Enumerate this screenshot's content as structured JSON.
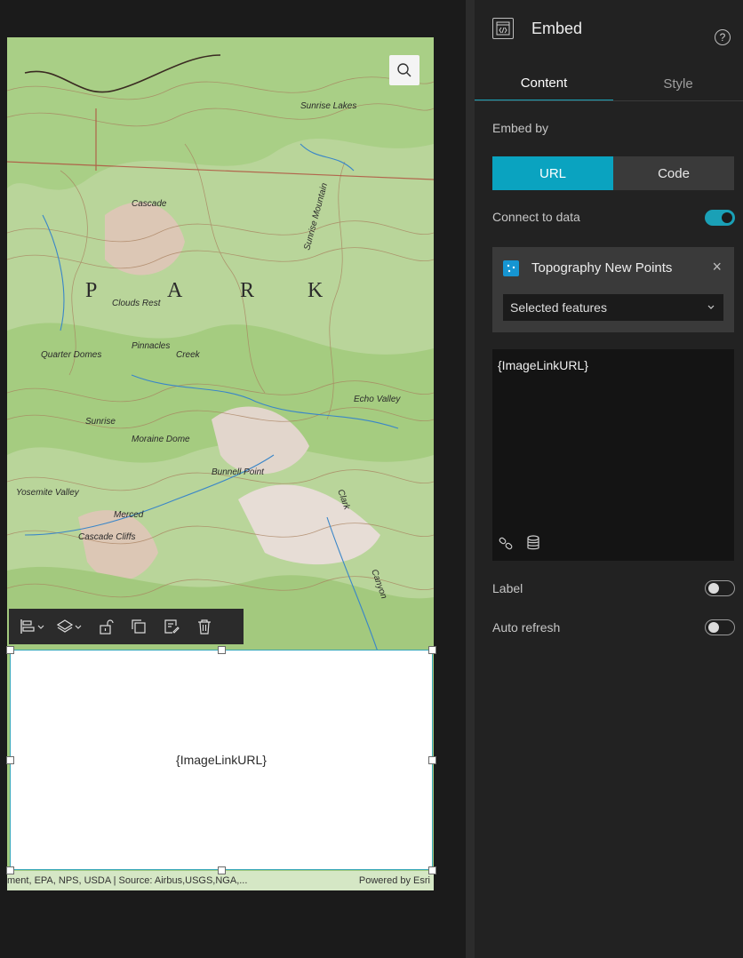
{
  "map": {
    "labels": {
      "park_letters": [
        "P",
        "A",
        "R",
        "K"
      ],
      "places": [
        "Clouds Rest",
        "Pinnacles",
        "Quarter Domes",
        "Sunrise",
        "Moraine Dome",
        "Bunnell Point",
        "Yosemite Valley",
        "Merced",
        "Cascade Cliffs",
        "Echo Valley",
        "Sunrise Mountain",
        "Sunrise Lakes",
        "Cascade",
        "Creek",
        "Clark",
        "Canyon"
      ]
    },
    "attribution_text": "ment, EPA, NPS, USDA | Source: Airbus,USGS,NGA,...",
    "powered_by": "Powered by Esri"
  },
  "icons": {
    "map_search": "search-icon",
    "toolbar": [
      "align-icon",
      "layers-icon",
      "unlock-icon",
      "duplicate-icon",
      "edit-data-icon",
      "trash-icon"
    ],
    "panel_header": "embed-code-icon",
    "help": "help-icon",
    "close": "close-icon",
    "link": "link-icon",
    "database": "database-icon",
    "chevron": "chevron-down-icon"
  },
  "embed_widget": {
    "content": "{ImageLinkURL}"
  },
  "panel": {
    "title": "Embed",
    "help_symbol": "?",
    "tabs": [
      "Content",
      "Style"
    ],
    "embed_by_label": "Embed by",
    "embed_by_options": [
      "URL",
      "Code"
    ],
    "embed_by_selected": "URL",
    "connect_label": "Connect to data",
    "connect_on": true,
    "data_source": {
      "name": "Topography New Points",
      "close_symbol": "×",
      "selection": "Selected features"
    },
    "url_value": "{ImageLinkURL}",
    "label_toggle": "Label",
    "label_on": false,
    "auto_refresh": "Auto refresh",
    "auto_refresh_on": false
  },
  "colors": {
    "accent": "#0aa3c0",
    "panel_bg": "#222222",
    "canvas_bg": "#1b1b1b",
    "input_bg": "#141414",
    "card_bg": "#3a3a3a"
  }
}
